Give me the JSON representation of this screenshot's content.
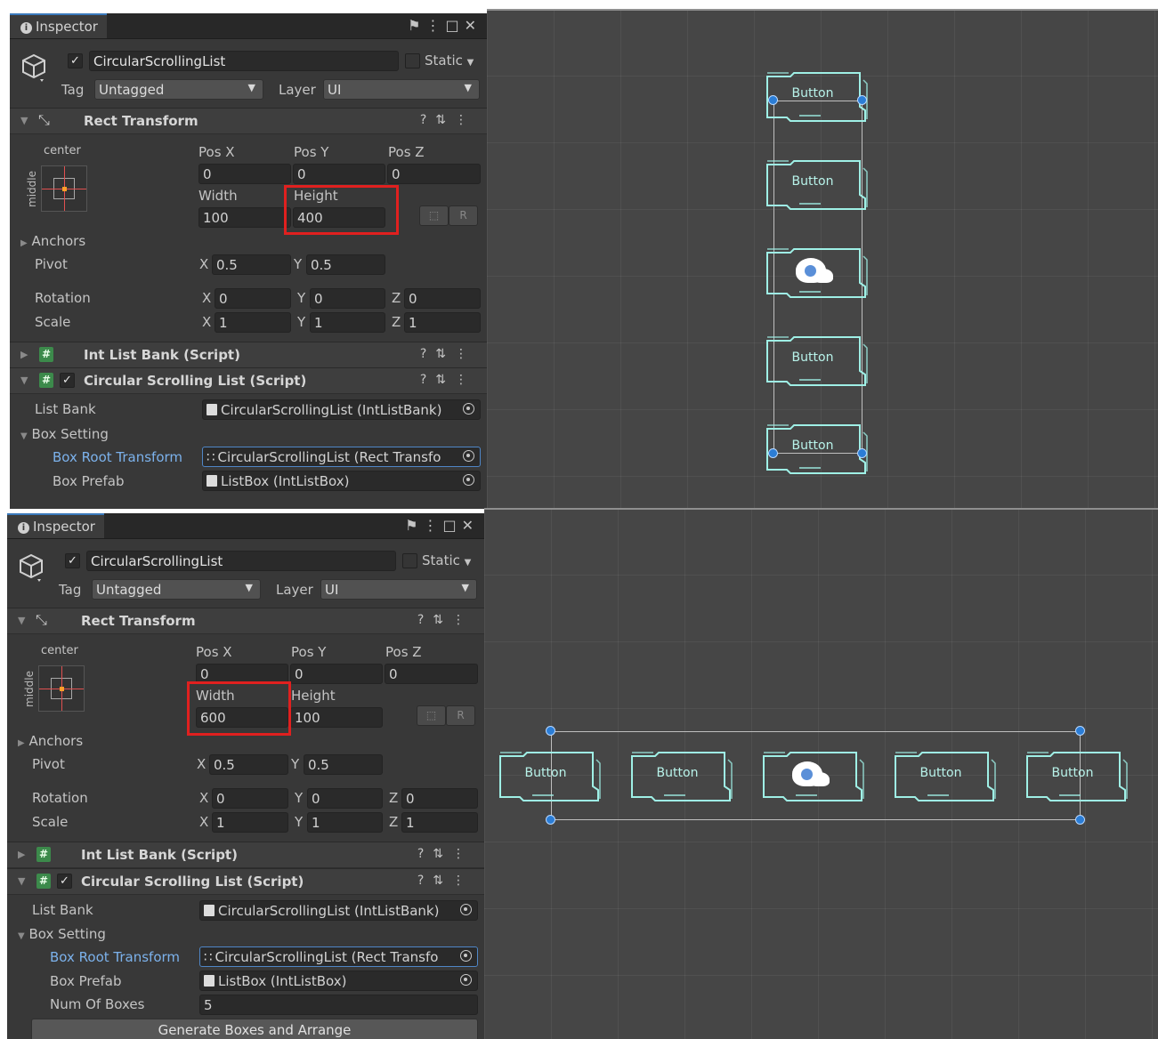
{
  "inspector": {
    "tab_label": "Inspector",
    "object_name": "CircularScrollingList",
    "static_label": "Static",
    "tag_label": "Tag",
    "tag_value": "Untagged",
    "layer_label": "Layer",
    "layer_value": "UI",
    "rect_transform_title": "Rect Transform",
    "anchor_preset_h": "center",
    "anchor_preset_v": "middle",
    "pos_x_label": "Pos X",
    "pos_y_label": "Pos Y",
    "pos_z_label": "Pos Z",
    "width_label": "Width",
    "height_label": "Height",
    "anchors_label": "Anchors",
    "pivot_label": "Pivot",
    "rotation_label": "Rotation",
    "scale_label": "Scale",
    "x_label": "X",
    "y_label": "Y",
    "z_label": "Z",
    "raw_button_label": "R",
    "int_list_bank_title": "Int List Bank (Script)",
    "circular_list_title": "Circular Scrolling List (Script)",
    "list_bank_label": "List Bank",
    "list_bank_value": "CircularScrollingList (IntListBank)",
    "box_setting_label": "Box Setting",
    "box_root_label": "Box Root Transform",
    "box_root_value": "CircularScrollingList (Rect Transfo",
    "box_prefab_label": "Box Prefab",
    "box_prefab_value": "ListBox (IntListBox)",
    "num_boxes_label": "Num Of Boxes",
    "num_boxes_value": "5",
    "generate_label": "Generate Boxes and Arrange"
  },
  "top": {
    "pos_x": "0",
    "pos_y": "0",
    "pos_z": "0",
    "width": "100",
    "height": "400",
    "pivot_x": "0.5",
    "pivot_y": "0.5",
    "rot_x": "0",
    "rot_y": "0",
    "rot_z": "0",
    "scale_x": "1",
    "scale_y": "1",
    "scale_z": "1"
  },
  "bottom": {
    "pos_x": "0",
    "pos_y": "0",
    "pos_z": "0",
    "width": "600",
    "height": "100",
    "pivot_x": "0.5",
    "pivot_y": "0.5",
    "rot_x": "0",
    "rot_y": "0",
    "rot_z": "0",
    "scale_x": "1",
    "scale_y": "1",
    "scale_z": "1"
  },
  "scene": {
    "button_label": "Button",
    "box_count_top": 5,
    "box_count_bottom": 5
  },
  "colors": {
    "highlight": "#e0201f",
    "handle": "#2b7dd6",
    "box_outline": "#9ff0e6",
    "script_icon": "#3c8a4b"
  }
}
